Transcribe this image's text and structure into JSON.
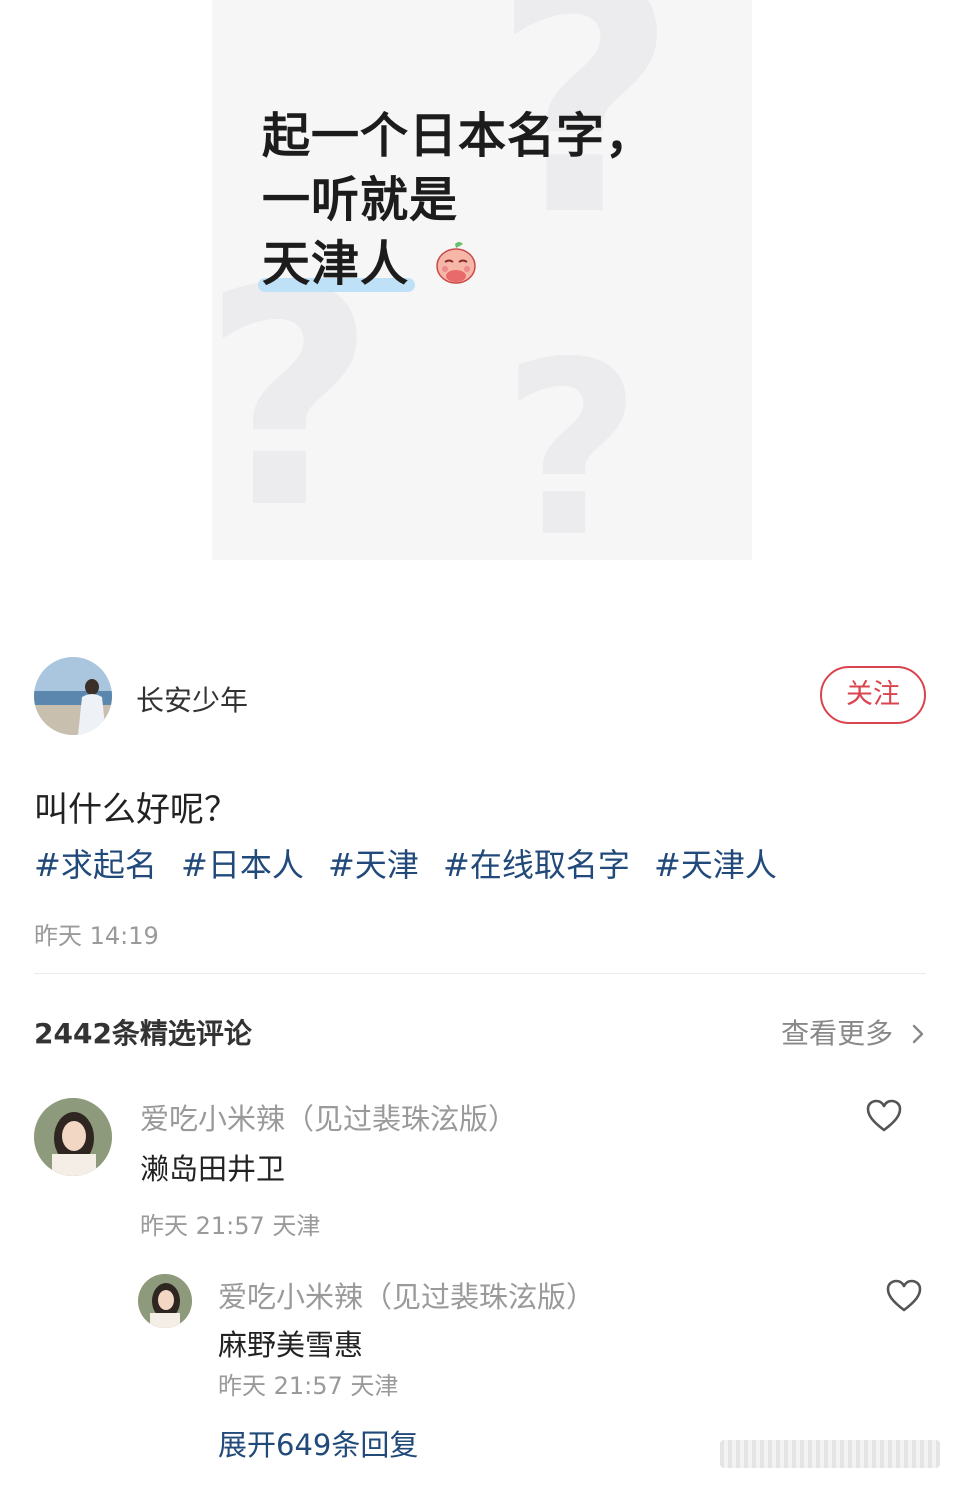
{
  "cover": {
    "title_line1": "起一个日本名字，",
    "title_line2": "一听就是",
    "title_line3": "天津人"
  },
  "author": {
    "name": "长安少年",
    "follow_label": "关注"
  },
  "post": {
    "text": "叫什么好呢？",
    "tags": [
      "#求起名",
      "#日本人",
      "#天津",
      "#在线取名字",
      "#天津人"
    ],
    "time": "昨天 14:19"
  },
  "comments": {
    "header": "2442条精选评论",
    "see_more": "查看更多",
    "items": [
      {
        "user": "爱吃小米辣（见过裴珠泫版）",
        "text": "濑岛田井卫",
        "meta": "昨天 21:57 天津",
        "reply": {
          "user": "爱吃小米辣（见过裴珠泫版）",
          "text": "麻野美雪惠",
          "meta": "昨天 21:57 天津"
        },
        "expand_label": "展开649条回复"
      }
    ]
  },
  "icons": {
    "heart": "heart-outline-icon",
    "chevron": "chevron-right-icon",
    "sticker": "peach-sticker-icon"
  },
  "colors": {
    "follow_accent": "#d9444f",
    "tag_blue": "#214a7a",
    "muted_gray": "#9a9a9a"
  }
}
